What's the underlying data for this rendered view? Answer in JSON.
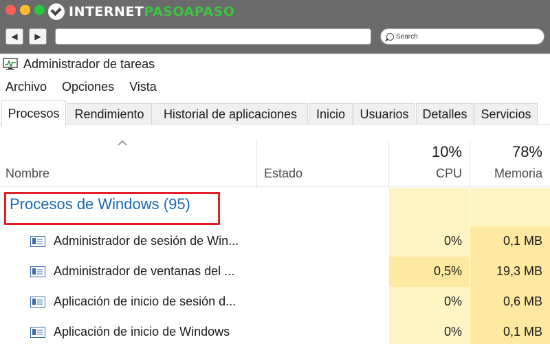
{
  "browser": {
    "brand_white": "INTERNET",
    "brand_green": "PASOAPASO",
    "back_icon": "◀",
    "forward_icon": "▶",
    "search_placeholder": "Search"
  },
  "window": {
    "title": "Administrador de tareas"
  },
  "menu": {
    "items": [
      "Archivo",
      "Opciones",
      "Vista"
    ]
  },
  "tabs": [
    "Procesos",
    "Rendimiento",
    "Historial de aplicaciones",
    "Inicio",
    "Usuarios",
    "Detalles",
    "Servicios"
  ],
  "columns": {
    "name": "Nombre",
    "state": "Estado",
    "cpu_pct": "10%",
    "cpu": "CPU",
    "mem_pct": "78%",
    "mem": "Memoria"
  },
  "group": {
    "label": "Procesos de Windows (95)"
  },
  "rows": [
    {
      "name": "Administrador de sesión de Win...",
      "cpu": "0%",
      "mem": "0,1 MB"
    },
    {
      "name": "Administrador de ventanas del ...",
      "cpu": "0,5%",
      "mem": "19,3 MB"
    },
    {
      "name": "Aplicación de inicio de sesión d...",
      "cpu": "0%",
      "mem": "0,6 MB"
    },
    {
      "name": "Aplicación de inicio de Windows",
      "cpu": "0%",
      "mem": "0,1 MB"
    }
  ],
  "colors": {
    "group_text": "#1a6ab3",
    "highlight_border": "#e21f26",
    "column_shade": "#fff4c4",
    "column_shade_strong": "#ffe9a0"
  }
}
